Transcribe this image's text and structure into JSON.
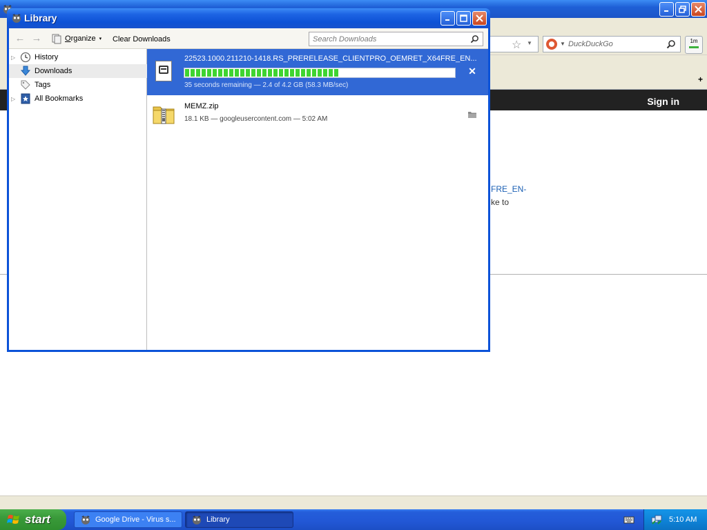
{
  "background_browser": {
    "search_placeholder": "DuckDuckGo",
    "addon_label": "1m",
    "sign_in": "Sign in",
    "visible_text_line1": "FRE_EN-",
    "visible_text_line2": "ke to"
  },
  "library_window": {
    "title": "Library",
    "toolbar": {
      "organize_label_u": "O",
      "organize_label_rest": "rganize",
      "organize_caret": "▾",
      "clear_downloads": "Clear Downloads",
      "search_placeholder": "Search Downloads"
    },
    "sidebar": {
      "items": [
        {
          "label": "History",
          "icon": "clock-icon",
          "expandable": true
        },
        {
          "label": "Downloads",
          "icon": "download-arrow-icon",
          "expandable": false,
          "selected": true
        },
        {
          "label": "Tags",
          "icon": "tag-icon",
          "expandable": false
        },
        {
          "label": "All Bookmarks",
          "icon": "bookmarks-icon",
          "expandable": true
        }
      ]
    },
    "downloads": [
      {
        "name": "22523.1000.211210-1418.RS_PRERELEASE_CLIENTPRO_OEMRET_X64FRE_EN...",
        "status": "35 seconds remaining — 2.4 of 4.2 GB (58.3 MB/sec)",
        "progress_fraction": 0.57,
        "action_icon": "cancel-icon",
        "action_symbol": "✕"
      },
      {
        "name": "MEMZ.zip",
        "status": "18.1 KB — googleusercontent.com — 5:02 AM",
        "action_icon": "folder-icon"
      }
    ]
  },
  "taskbar": {
    "start_label": "start",
    "buttons": [
      {
        "label": "Google Drive - Virus s...",
        "icon": "browser-icon",
        "active": false
      },
      {
        "label": "Library",
        "icon": "browser-icon",
        "active": true
      }
    ],
    "clock": "5:10 AM"
  },
  "colors": {
    "xp_title_blue": "#0e52d6",
    "selected_row": "#3168d5",
    "progress_green": "#3fd431",
    "taskbar_blue": "#245edb",
    "start_green": "#3a9a3a"
  }
}
